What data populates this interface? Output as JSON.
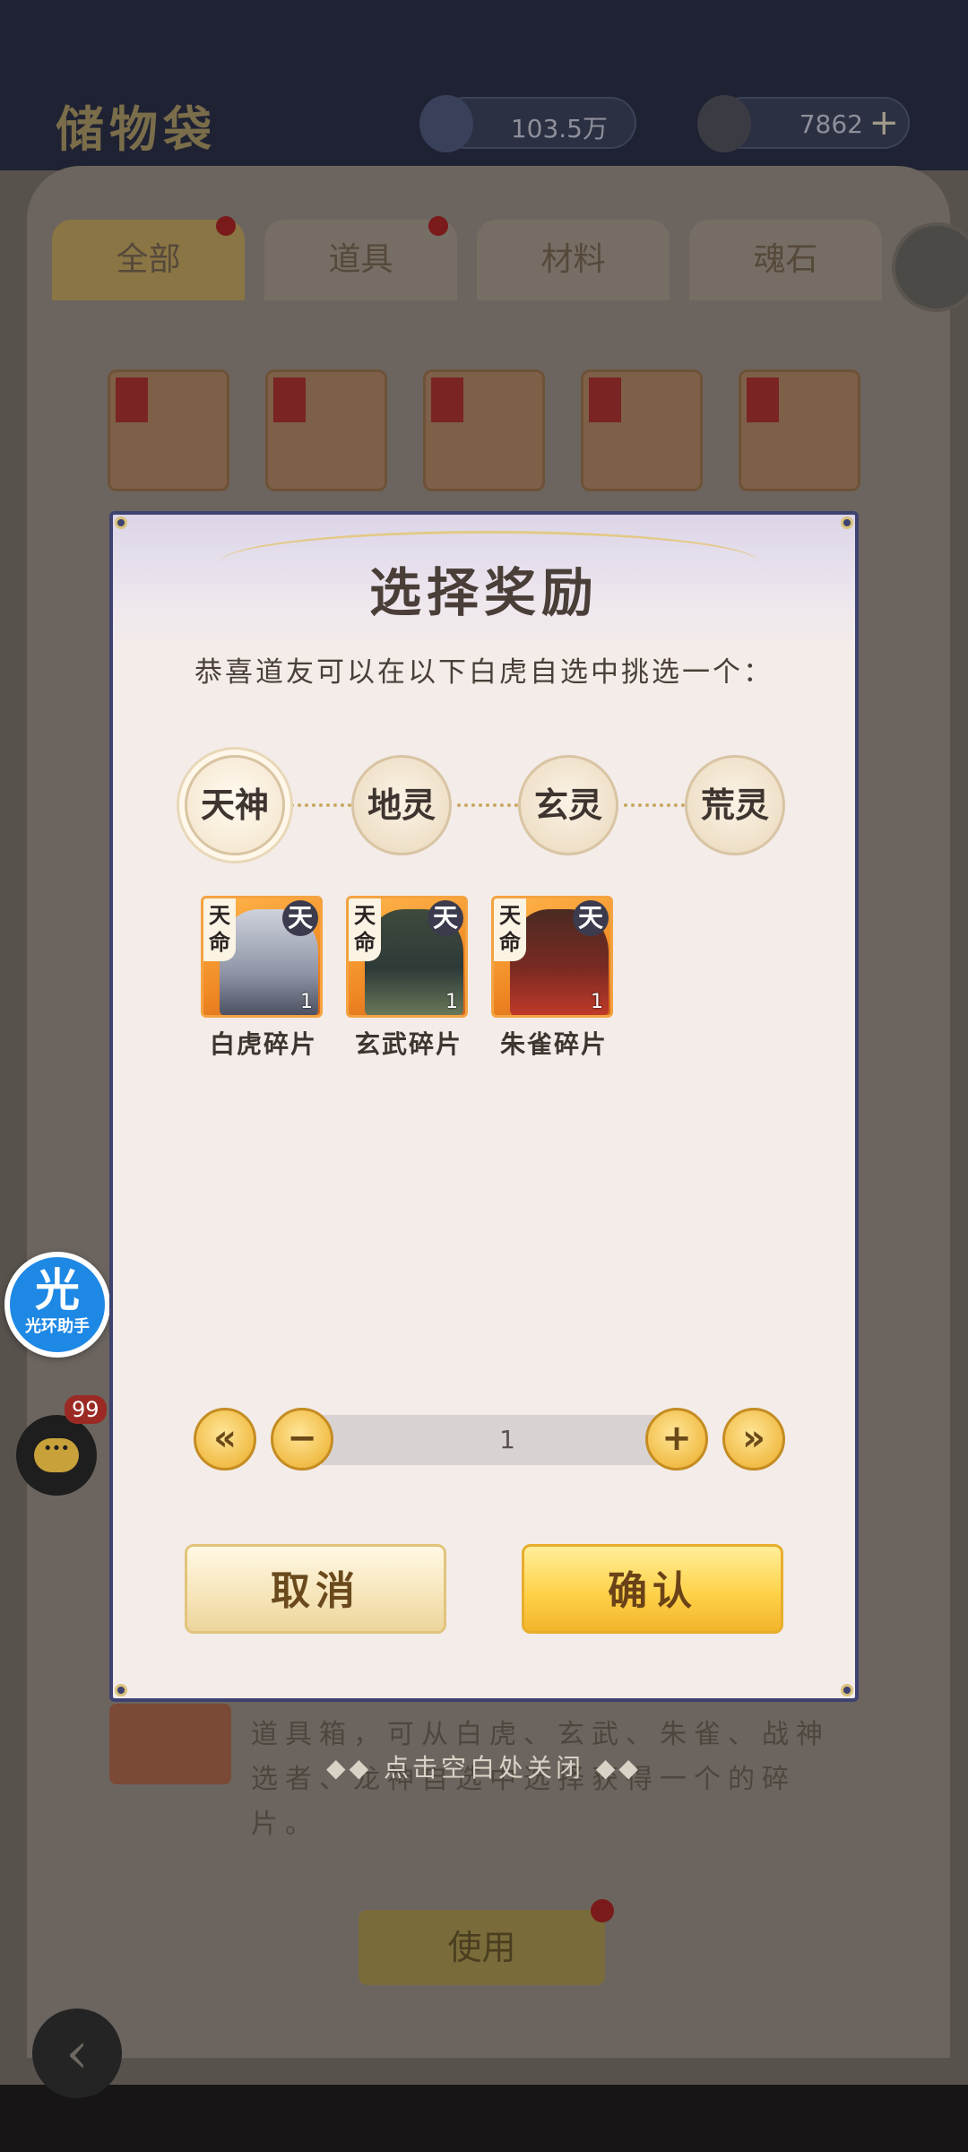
{
  "background": {
    "screen_title": "储物袋",
    "resources": [
      {
        "icon": "spirit-stone-icon",
        "value": "103.5万"
      },
      {
        "icon": "lightning-icon",
        "value": "7862"
      }
    ],
    "tabs": [
      {
        "label": "全部",
        "has_dot": true,
        "active": true
      },
      {
        "label": "道具",
        "has_dot": true,
        "active": false
      },
      {
        "label": "材料",
        "has_dot": false,
        "active": false
      },
      {
        "label": "魂石",
        "has_dot": false,
        "active": false
      }
    ],
    "item_description": "道具箱，可从白虎、玄武、朱雀、战神选者、龙神自选中选择获得一个的碎片。",
    "use_button": "使用",
    "close_hint": "◆◆ 点击空白处关闭 ◆◆"
  },
  "overlays": {
    "assistant_icon_text": "光",
    "assistant_label": "光环助手",
    "chat_badge": "99"
  },
  "dialog": {
    "title": "选择奖励",
    "subtitle": "恭喜道友可以在以下白虎自选中挑选一个：",
    "choices": [
      {
        "label": "天神",
        "selected": true
      },
      {
        "label": "地灵",
        "selected": false
      },
      {
        "label": "玄灵",
        "selected": false
      },
      {
        "label": "荒灵",
        "selected": false
      }
    ],
    "rewards": [
      {
        "tag": "天命",
        "rank": "天",
        "count": "1",
        "name": "白虎碎片"
      },
      {
        "tag": "天命",
        "rank": "天",
        "count": "1",
        "name": "玄武碎片"
      },
      {
        "tag": "天命",
        "rank": "天",
        "count": "1",
        "name": "朱雀碎片"
      }
    ],
    "quantity": {
      "value": "1",
      "first_symbol": "«",
      "minus_symbol": "−",
      "plus_symbol": "+",
      "last_symbol": "»"
    },
    "cancel_label": "取消",
    "confirm_label": "确认"
  },
  "colors": {
    "dialog_bg": "#f3ece9",
    "dialog_border": "#3d4270",
    "gold_button": "#ffd24a",
    "card_orange": "#f08a24"
  }
}
